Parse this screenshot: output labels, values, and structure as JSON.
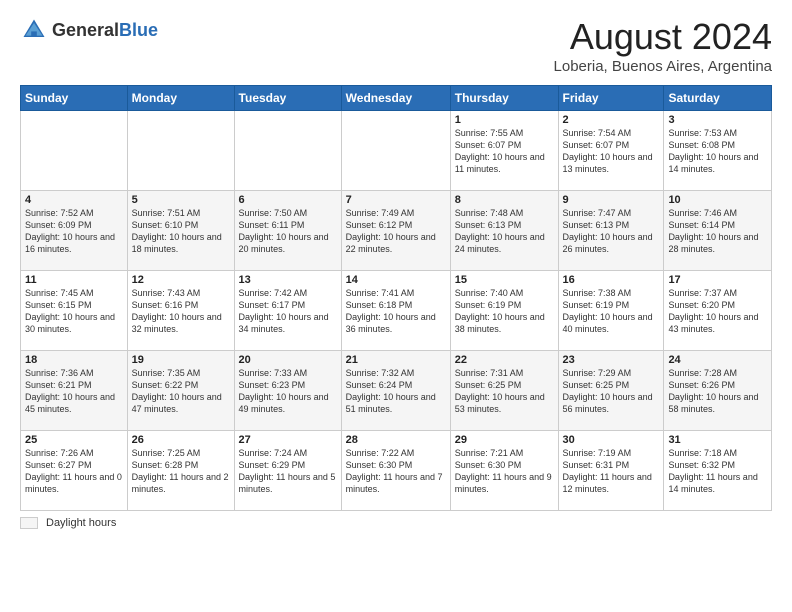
{
  "header": {
    "logo_general": "General",
    "logo_blue": "Blue",
    "title": "August 2024",
    "location": "Loberia, Buenos Aires, Argentina"
  },
  "days_of_week": [
    "Sunday",
    "Monday",
    "Tuesday",
    "Wednesday",
    "Thursday",
    "Friday",
    "Saturday"
  ],
  "weeks": [
    [
      {
        "day": "",
        "content": ""
      },
      {
        "day": "",
        "content": ""
      },
      {
        "day": "",
        "content": ""
      },
      {
        "day": "",
        "content": ""
      },
      {
        "day": "1",
        "content": "Sunrise: 7:55 AM\nSunset: 6:07 PM\nDaylight: 10 hours\nand 11 minutes."
      },
      {
        "day": "2",
        "content": "Sunrise: 7:54 AM\nSunset: 6:07 PM\nDaylight: 10 hours\nand 13 minutes."
      },
      {
        "day": "3",
        "content": "Sunrise: 7:53 AM\nSunset: 6:08 PM\nDaylight: 10 hours\nand 14 minutes."
      }
    ],
    [
      {
        "day": "4",
        "content": "Sunrise: 7:52 AM\nSunset: 6:09 PM\nDaylight: 10 hours\nand 16 minutes."
      },
      {
        "day": "5",
        "content": "Sunrise: 7:51 AM\nSunset: 6:10 PM\nDaylight: 10 hours\nand 18 minutes."
      },
      {
        "day": "6",
        "content": "Sunrise: 7:50 AM\nSunset: 6:11 PM\nDaylight: 10 hours\nand 20 minutes."
      },
      {
        "day": "7",
        "content": "Sunrise: 7:49 AM\nSunset: 6:12 PM\nDaylight: 10 hours\nand 22 minutes."
      },
      {
        "day": "8",
        "content": "Sunrise: 7:48 AM\nSunset: 6:13 PM\nDaylight: 10 hours\nand 24 minutes."
      },
      {
        "day": "9",
        "content": "Sunrise: 7:47 AM\nSunset: 6:13 PM\nDaylight: 10 hours\nand 26 minutes."
      },
      {
        "day": "10",
        "content": "Sunrise: 7:46 AM\nSunset: 6:14 PM\nDaylight: 10 hours\nand 28 minutes."
      }
    ],
    [
      {
        "day": "11",
        "content": "Sunrise: 7:45 AM\nSunset: 6:15 PM\nDaylight: 10 hours\nand 30 minutes."
      },
      {
        "day": "12",
        "content": "Sunrise: 7:43 AM\nSunset: 6:16 PM\nDaylight: 10 hours\nand 32 minutes."
      },
      {
        "day": "13",
        "content": "Sunrise: 7:42 AM\nSunset: 6:17 PM\nDaylight: 10 hours\nand 34 minutes."
      },
      {
        "day": "14",
        "content": "Sunrise: 7:41 AM\nSunset: 6:18 PM\nDaylight: 10 hours\nand 36 minutes."
      },
      {
        "day": "15",
        "content": "Sunrise: 7:40 AM\nSunset: 6:19 PM\nDaylight: 10 hours\nand 38 minutes."
      },
      {
        "day": "16",
        "content": "Sunrise: 7:38 AM\nSunset: 6:19 PM\nDaylight: 10 hours\nand 40 minutes."
      },
      {
        "day": "17",
        "content": "Sunrise: 7:37 AM\nSunset: 6:20 PM\nDaylight: 10 hours\nand 43 minutes."
      }
    ],
    [
      {
        "day": "18",
        "content": "Sunrise: 7:36 AM\nSunset: 6:21 PM\nDaylight: 10 hours\nand 45 minutes."
      },
      {
        "day": "19",
        "content": "Sunrise: 7:35 AM\nSunset: 6:22 PM\nDaylight: 10 hours\nand 47 minutes."
      },
      {
        "day": "20",
        "content": "Sunrise: 7:33 AM\nSunset: 6:23 PM\nDaylight: 10 hours\nand 49 minutes."
      },
      {
        "day": "21",
        "content": "Sunrise: 7:32 AM\nSunset: 6:24 PM\nDaylight: 10 hours\nand 51 minutes."
      },
      {
        "day": "22",
        "content": "Sunrise: 7:31 AM\nSunset: 6:25 PM\nDaylight: 10 hours\nand 53 minutes."
      },
      {
        "day": "23",
        "content": "Sunrise: 7:29 AM\nSunset: 6:25 PM\nDaylight: 10 hours\nand 56 minutes."
      },
      {
        "day": "24",
        "content": "Sunrise: 7:28 AM\nSunset: 6:26 PM\nDaylight: 10 hours\nand 58 minutes."
      }
    ],
    [
      {
        "day": "25",
        "content": "Sunrise: 7:26 AM\nSunset: 6:27 PM\nDaylight: 11 hours\nand 0 minutes."
      },
      {
        "day": "26",
        "content": "Sunrise: 7:25 AM\nSunset: 6:28 PM\nDaylight: 11 hours\nand 2 minutes."
      },
      {
        "day": "27",
        "content": "Sunrise: 7:24 AM\nSunset: 6:29 PM\nDaylight: 11 hours\nand 5 minutes."
      },
      {
        "day": "28",
        "content": "Sunrise: 7:22 AM\nSunset: 6:30 PM\nDaylight: 11 hours\nand 7 minutes."
      },
      {
        "day": "29",
        "content": "Sunrise: 7:21 AM\nSunset: 6:30 PM\nDaylight: 11 hours\nand 9 minutes."
      },
      {
        "day": "30",
        "content": "Sunrise: 7:19 AM\nSunset: 6:31 PM\nDaylight: 11 hours\nand 12 minutes."
      },
      {
        "day": "31",
        "content": "Sunrise: 7:18 AM\nSunset: 6:32 PM\nDaylight: 11 hours\nand 14 minutes."
      }
    ]
  ],
  "footer": {
    "legend_label": "Daylight hours"
  }
}
